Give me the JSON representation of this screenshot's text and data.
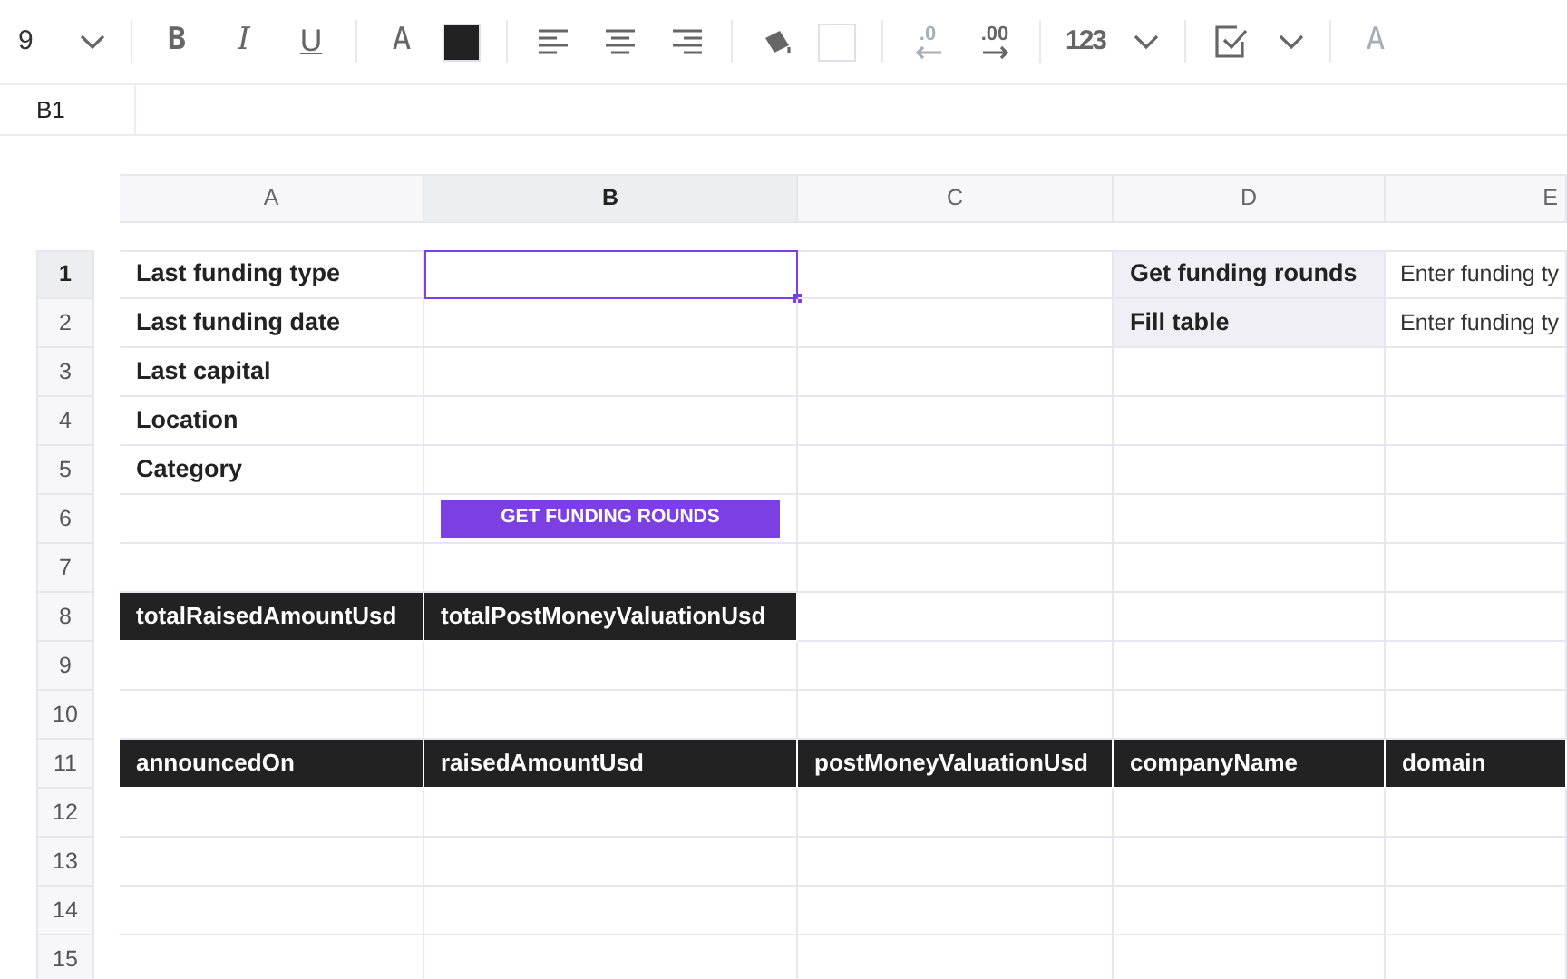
{
  "toolbar": [
    {
      "kind": "font-size",
      "label": "9"
    },
    {
      "kind": "caret"
    },
    {
      "kind": "separator"
    },
    {
      "kind": "bold",
      "label": "B",
      "disabled": false
    },
    {
      "kind": "italic",
      "label": "I",
      "disabled": false
    },
    {
      "kind": "underline",
      "label": "U",
      "disabled": false
    },
    {
      "kind": "separator"
    },
    {
      "kind": "text-color",
      "label": "A",
      "disabled": false
    },
    {
      "kind": "swatch",
      "color": "#222222"
    },
    {
      "kind": "separator"
    },
    {
      "kind": "align-left",
      "disabled": false
    },
    {
      "kind": "align-center",
      "disabled": false
    },
    {
      "kind": "align-right",
      "disabled": false
    },
    {
      "kind": "separator"
    },
    {
      "kind": "fill",
      "disabled": false
    },
    {
      "kind": "swatch",
      "color": "#ffffff"
    },
    {
      "kind": "separator"
    },
    {
      "kind": "decimal-decrease",
      "label": ".0",
      "disabled": true
    },
    {
      "kind": "decimal-increase",
      "label": ".00",
      "disabled": false
    },
    {
      "kind": "separator"
    },
    {
      "kind": "number-format",
      "label": "123",
      "disabled": false
    },
    {
      "kind": "caret"
    },
    {
      "kind": "separator"
    },
    {
      "kind": "checkbox",
      "disabled": false
    },
    {
      "kind": "caret"
    },
    {
      "kind": "separator"
    },
    {
      "kind": "clear-format",
      "label": "A",
      "disabled": true
    }
  ],
  "name_box": "B1",
  "columns": [
    {
      "label": "A",
      "selected": false
    },
    {
      "label": "B",
      "selected": true
    },
    {
      "label": "C",
      "selected": false
    },
    {
      "label": "D",
      "selected": false
    },
    {
      "label": "E",
      "selected": false
    }
  ],
  "rows": [
    {
      "number": "1",
      "selected": true,
      "cells": [
        {
          "kind": "label",
          "text": "Last funding type",
          "active": false
        },
        {
          "kind": "empty",
          "active": true
        },
        {
          "kind": "empty",
          "active": false
        },
        {
          "kind": "action",
          "text": "Get funding rounds",
          "active": false
        },
        {
          "kind": "input",
          "text": "Enter funding ty",
          "active": false
        }
      ]
    },
    {
      "number": "2",
      "selected": false,
      "cells": [
        {
          "kind": "label",
          "text": "Last funding date",
          "active": false
        },
        {
          "kind": "empty",
          "active": false
        },
        {
          "kind": "empty",
          "active": false
        },
        {
          "kind": "action",
          "text": "Fill table",
          "active": false
        },
        {
          "kind": "input",
          "text": "Enter funding ty",
          "active": false
        }
      ]
    },
    {
      "number": "3",
      "selected": false,
      "cells": [
        {
          "kind": "label",
          "text": "Last capital",
          "active": false
        },
        {
          "kind": "empty",
          "active": false
        },
        {
          "kind": "empty",
          "active": false
        },
        {
          "kind": "empty",
          "active": false
        },
        {
          "kind": "empty",
          "active": false
        }
      ]
    },
    {
      "number": "4",
      "selected": false,
      "cells": [
        {
          "kind": "label",
          "text": "Location",
          "active": false
        },
        {
          "kind": "empty",
          "active": false
        },
        {
          "kind": "empty",
          "active": false
        },
        {
          "kind": "empty",
          "active": false
        },
        {
          "kind": "empty",
          "active": false
        }
      ]
    },
    {
      "number": "5",
      "selected": false,
      "cells": [
        {
          "kind": "label",
          "text": "Category",
          "active": false
        },
        {
          "kind": "empty",
          "active": false
        },
        {
          "kind": "empty",
          "active": false
        },
        {
          "kind": "empty",
          "active": false
        },
        {
          "kind": "empty",
          "active": false
        }
      ]
    },
    {
      "number": "6",
      "selected": false,
      "cells": [
        {
          "kind": "empty",
          "active": false
        },
        {
          "kind": "button",
          "text": "GET FUNDING ROUNDS",
          "active": false
        },
        {
          "kind": "empty",
          "active": false
        },
        {
          "kind": "empty",
          "active": false
        },
        {
          "kind": "empty",
          "active": false
        }
      ]
    },
    {
      "number": "7",
      "selected": false,
      "cells": [
        {
          "kind": "empty",
          "active": false
        },
        {
          "kind": "empty",
          "active": false
        },
        {
          "kind": "empty",
          "active": false
        },
        {
          "kind": "empty",
          "active": false
        },
        {
          "kind": "empty",
          "active": false
        }
      ]
    },
    {
      "number": "8",
      "selected": false,
      "cells": [
        {
          "kind": "header",
          "text": "totalRaisedAmountUsd",
          "active": false
        },
        {
          "kind": "header",
          "text": "totalPostMoneyValuationUsd",
          "active": false
        },
        {
          "kind": "empty",
          "active": false
        },
        {
          "kind": "empty",
          "active": false
        },
        {
          "kind": "empty",
          "active": false
        }
      ]
    },
    {
      "number": "9",
      "selected": false,
      "cells": [
        {
          "kind": "empty",
          "active": false
        },
        {
          "kind": "empty",
          "active": false
        },
        {
          "kind": "empty",
          "active": false
        },
        {
          "kind": "empty",
          "active": false
        },
        {
          "kind": "empty",
          "active": false
        }
      ]
    },
    {
      "number": "10",
      "selected": false,
      "cells": [
        {
          "kind": "empty",
          "active": false
        },
        {
          "kind": "empty",
          "active": false
        },
        {
          "kind": "empty",
          "active": false
        },
        {
          "kind": "empty",
          "active": false
        },
        {
          "kind": "empty",
          "active": false
        }
      ]
    },
    {
      "number": "11",
      "selected": false,
      "cells": [
        {
          "kind": "header",
          "text": "announcedOn",
          "active": false
        },
        {
          "kind": "header",
          "text": "raisedAmountUsd",
          "active": false
        },
        {
          "kind": "header",
          "text": "postMoneyValuationUsd",
          "active": false
        },
        {
          "kind": "header",
          "text": "companyName",
          "active": false
        },
        {
          "kind": "header",
          "text": "domain",
          "active": false
        }
      ]
    },
    {
      "number": "12",
      "selected": false,
      "cells": [
        {
          "kind": "empty",
          "active": false
        },
        {
          "kind": "empty",
          "active": false
        },
        {
          "kind": "empty",
          "active": false
        },
        {
          "kind": "empty",
          "active": false
        },
        {
          "kind": "empty",
          "active": false
        }
      ]
    },
    {
      "number": "13",
      "selected": false,
      "cells": [
        {
          "kind": "empty",
          "active": false
        },
        {
          "kind": "empty",
          "active": false
        },
        {
          "kind": "empty",
          "active": false
        },
        {
          "kind": "empty",
          "active": false
        },
        {
          "kind": "empty",
          "active": false
        }
      ]
    },
    {
      "number": "14",
      "selected": false,
      "cells": [
        {
          "kind": "empty",
          "active": false
        },
        {
          "kind": "empty",
          "active": false
        },
        {
          "kind": "empty",
          "active": false
        },
        {
          "kind": "empty",
          "active": false
        },
        {
          "kind": "empty",
          "active": false
        }
      ]
    },
    {
      "number": "15",
      "selected": false,
      "cells": [
        {
          "kind": "empty",
          "active": false
        },
        {
          "kind": "empty",
          "active": false
        },
        {
          "kind": "empty",
          "active": false
        },
        {
          "kind": "empty",
          "active": false
        },
        {
          "kind": "empty",
          "active": false
        }
      ]
    }
  ]
}
